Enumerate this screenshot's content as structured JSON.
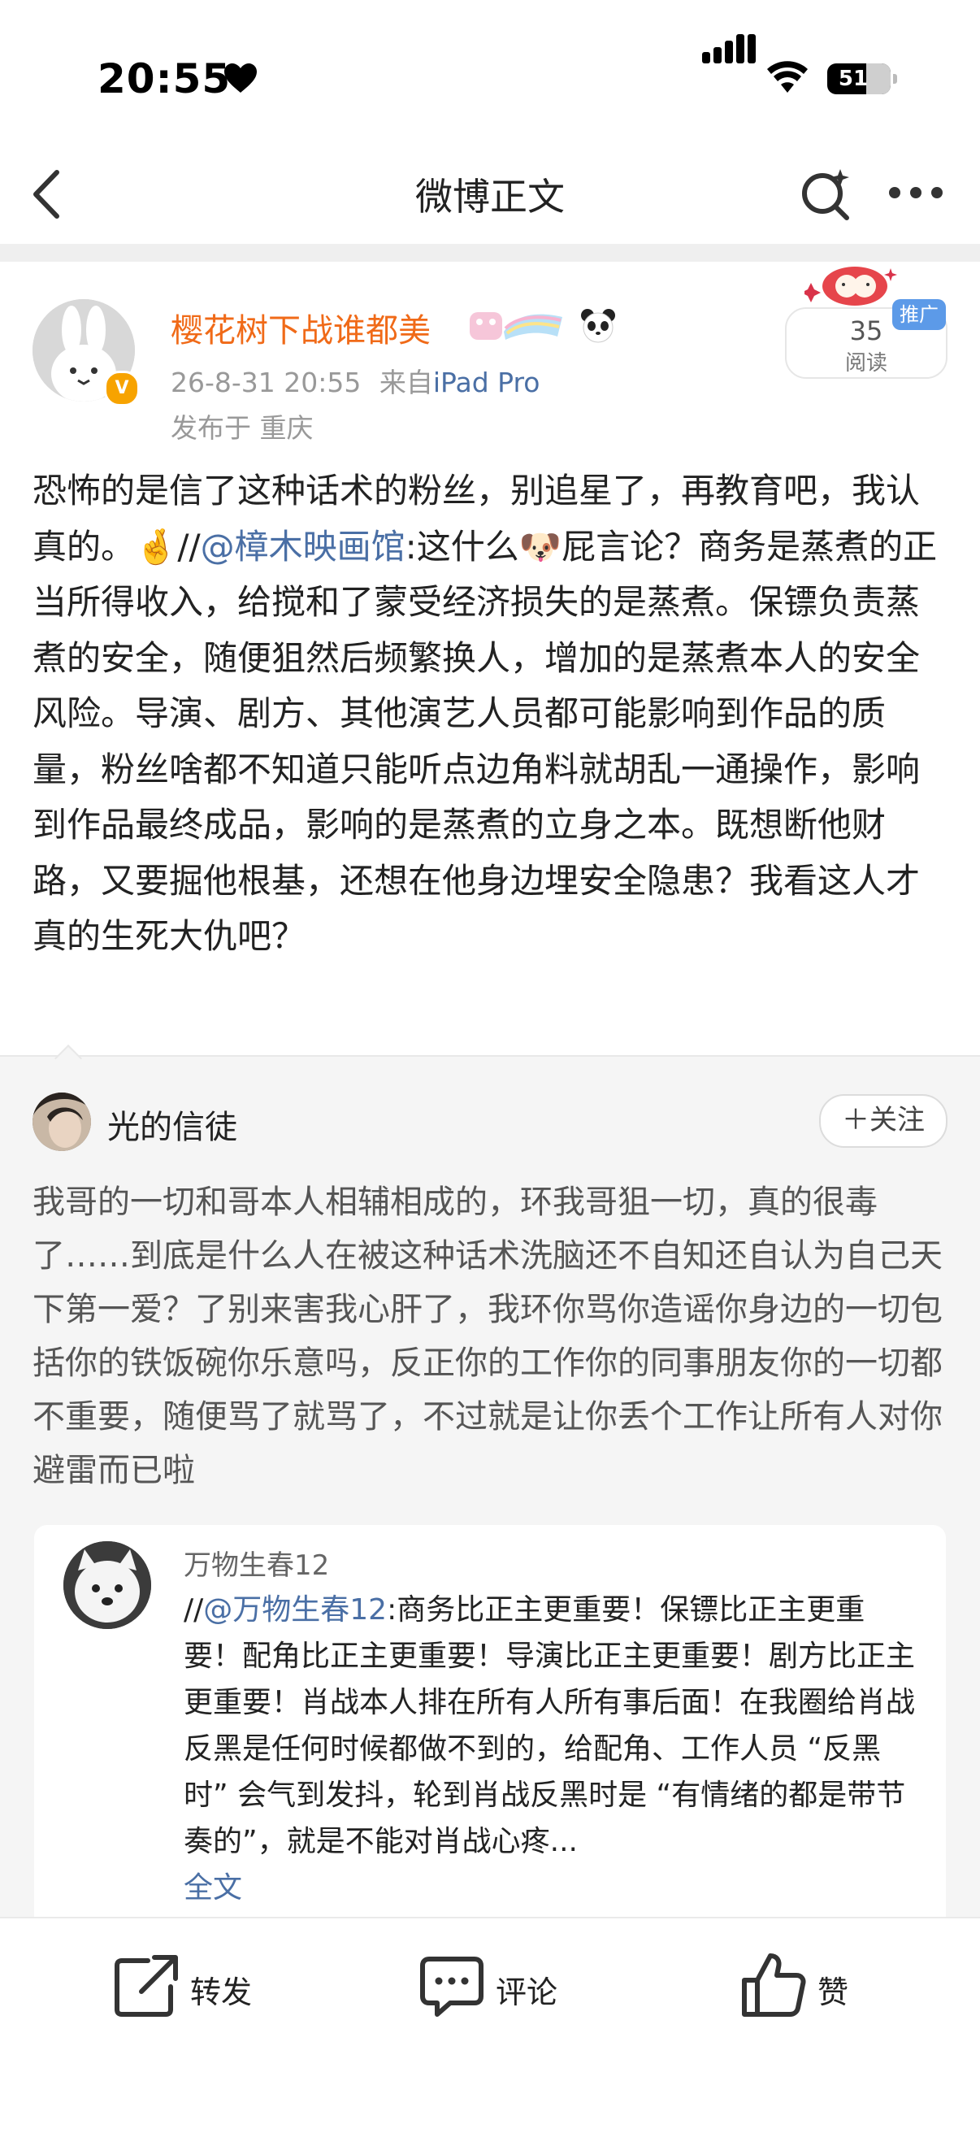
{
  "status_bar": {
    "time": "20:55",
    "battery": "51"
  },
  "nav": {
    "title": "微博正文"
  },
  "post": {
    "username": "樱花树下战谁都美",
    "verified_badge": "V",
    "time": "26-8-31 20:55",
    "source_prefix": "来自",
    "source": "iPad Pro",
    "location": "发布于 重庆",
    "read_count": "35",
    "read_label": "阅读",
    "promo_label": "推广",
    "text_part1": "恐怖的是信了这种话术的粉丝，别追星了，再教育吧，我认真的。",
    "text_emoji1": "🤞",
    "text_repost_prefix": "//",
    "mention": "@樟木映画馆",
    "text_part2": ":这什么",
    "text_emoji2": "🐶",
    "text_part3": "屁言论？商务是蒸煮的正当所得收入，给搅和了蒙受经济损失的是蒸煮。保镖负责蒸煮的安全，随便狙然后频繁换人，增加的是蒸煮本人的安全风险。导演、剧方、其他演艺人员都可能影响到作品的质量，粉丝啥都不知道只能听点边角料就胡乱一通操作，影响到作品最终成品，影响的是蒸煮的立身之本。既想断他财路，又要掘他根基，还想在他身边埋安全隐患？我看这人才真的生死大仇吧？"
  },
  "comment": {
    "username": "光的信徒",
    "follow_label": "＋关注",
    "text": "我哥的一切和哥本人相辅相成的，环我哥狙一切，真的很毒了……到底是什么人在被这种话术洗脑还不自知还自认为自己天下第一爱？了别来害我心肝了，我环你骂你造谣你身边的一切包括你的铁饭碗你乐意吗，反正你的工作你的同事朋友你的一切都不重要，随便骂了就骂了，不过就是让你丢个工作让所有人对你避雷而已啦"
  },
  "quote": {
    "username": "万物生春12",
    "prefix": "//",
    "mention": "@万物生春12",
    "text": ":商务比正主更重要！保镖比正主更重要！配角比正主更重要！导演比正主更重要！剧方比正主更重要！肖战本人排在所有人所有事后面！在我圈给肖战反黑是任何时候都做不到的，给配角、工作人员 “反黑时” 会气到发抖，轮到肖战反黑时是 “有情绪的都是带节奏的”，就是不能对肖战心疼...",
    "full_text_link": "全文"
  },
  "toolbar": {
    "repost": "转发",
    "comment": "评论",
    "like": "赞"
  }
}
